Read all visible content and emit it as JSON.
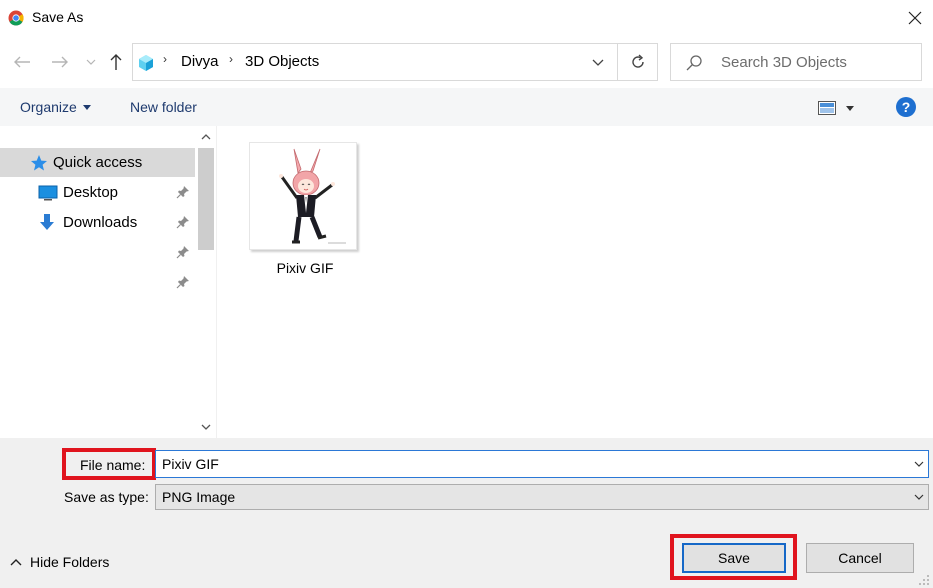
{
  "window": {
    "title": "Save As",
    "icon": "chrome-icon"
  },
  "nav": {
    "back_icon": "arrow-left-icon",
    "forward_icon": "arrow-right-icon",
    "recent_icon": "chevron-down-icon",
    "up_icon": "arrow-up-icon"
  },
  "address": {
    "icon": "3d-objects-icon",
    "crumbs": [
      "Divya",
      "3D Objects"
    ]
  },
  "search": {
    "placeholder": "Search 3D Objects"
  },
  "toolbar": {
    "organize_label": "Organize",
    "new_folder_label": "New folder",
    "help_label": "?"
  },
  "sidebar": {
    "items": [
      {
        "label": "Quick access",
        "icon": "star-icon"
      },
      {
        "label": "Desktop",
        "icon": "desktop-icon"
      },
      {
        "label": "Downloads",
        "icon": "download-arrow-icon"
      }
    ]
  },
  "files": [
    {
      "name": "Pixiv GIF"
    }
  ],
  "form": {
    "file_name_label": "File name:",
    "file_name_value": "Pixiv GIF",
    "save_type_label": "Save as type:",
    "save_type_value": "PNG Image"
  },
  "footer": {
    "hide_folders_label": "Hide Folders",
    "save_label": "Save",
    "cancel_label": "Cancel"
  },
  "colors": {
    "highlight_red": "#e0141e",
    "focus_blue": "#1668c7",
    "link_blue": "#1e3a6e"
  }
}
